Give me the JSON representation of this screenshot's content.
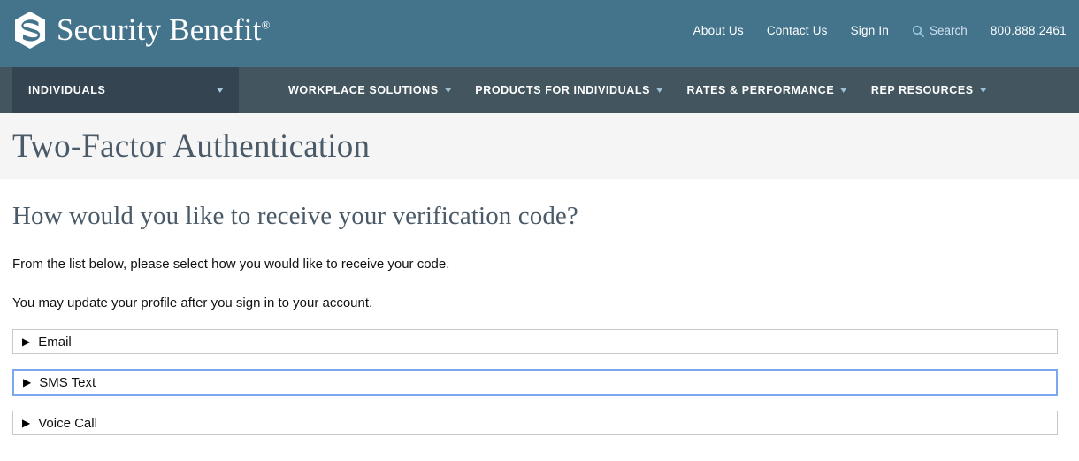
{
  "header": {
    "brand_name": "Security Benefit",
    "brand_registered": "®",
    "logo_icon": "security-benefit-hex-s-logo",
    "util_links": [
      {
        "label": "About Us"
      },
      {
        "label": "Contact Us"
      },
      {
        "label": "Sign In"
      }
    ],
    "search": {
      "label": "Search",
      "icon": "search-icon"
    },
    "phone": "800.888.2461",
    "background_color": "#44748c"
  },
  "mainnav": {
    "audience": {
      "label": "INDIVIDUALS",
      "caret_icon": "chevron-down-icon"
    },
    "items": [
      {
        "label": "WORKPLACE SOLUTIONS",
        "caret_icon": "chevron-down-icon"
      },
      {
        "label": "PRODUCTS FOR INDIVIDUALS",
        "caret_icon": "chevron-down-icon"
      },
      {
        "label": "RATES & PERFORMANCE",
        "caret_icon": "chevron-down-icon"
      },
      {
        "label": "REP RESOURCES",
        "caret_icon": "chevron-down-icon"
      }
    ],
    "background_color": "#43565f",
    "audience_background_color": "#344450"
  },
  "banner": {
    "title": "Two-Factor Authentication",
    "background_color": "#f5f5f5",
    "title_color": "#4a5a68"
  },
  "main": {
    "heading": "How would you like to receive your verification code?",
    "paragraph_1": "From the list below, please select how you would like to receive your code.",
    "paragraph_2": "You may update your profile after you sign in to your account.",
    "options": [
      {
        "label": "Email",
        "arrow_icon": "triangle-right-icon",
        "focused": false
      },
      {
        "label": "SMS Text",
        "arrow_icon": "triangle-right-icon",
        "focused": true
      },
      {
        "label": "Voice Call",
        "arrow_icon": "triangle-right-icon",
        "focused": false
      }
    ],
    "focus_border_color": "#7ba7ee",
    "border_color": "#c8c8c8"
  }
}
